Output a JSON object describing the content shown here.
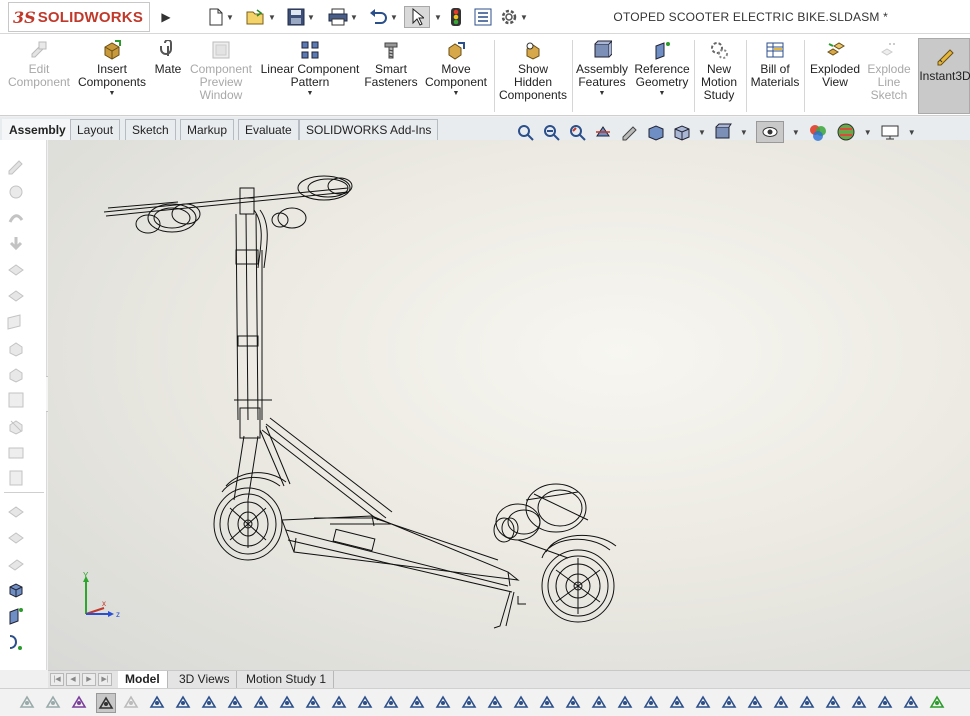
{
  "app": {
    "logo_mark": "3S",
    "logo_text": "SOLIDWORKS"
  },
  "titlebar": {
    "document_title": "OTOPED SCOOTER ELECTRIC BIKE.SLDASM *",
    "icons": [
      "new-document-icon",
      "open-icon",
      "save-icon",
      "print-icon",
      "undo-icon",
      "select-icon",
      "rebuild-icon",
      "file-properties-icon",
      "options-icon"
    ]
  },
  "command_manager": {
    "buttons": [
      {
        "label": "Edit\nComponent",
        "enabled": false,
        "has_dropdown": false,
        "icon": "edit-component-icon"
      },
      {
        "label": "Insert\nComponents",
        "enabled": true,
        "has_dropdown": true,
        "icon": "insert-components-icon"
      },
      {
        "label": "Mate",
        "enabled": true,
        "has_dropdown": false,
        "icon": "mate-icon"
      },
      {
        "label": "Component\nPreview\nWindow",
        "enabled": false,
        "has_dropdown": false,
        "icon": "component-preview-icon"
      },
      {
        "label": "Linear Component\nPattern",
        "enabled": true,
        "has_dropdown": true,
        "icon": "linear-pattern-icon"
      },
      {
        "label": "Smart\nFasteners",
        "enabled": true,
        "has_dropdown": false,
        "icon": "smart-fasteners-icon"
      },
      {
        "label": "Move\nComponent",
        "enabled": true,
        "has_dropdown": true,
        "icon": "move-component-icon"
      },
      {
        "label": "Show\nHidden\nComponents",
        "enabled": true,
        "has_dropdown": false,
        "icon": "show-hidden-icon"
      },
      {
        "label": "Assembly\nFeatures",
        "enabled": true,
        "has_dropdown": true,
        "icon": "assembly-features-icon"
      },
      {
        "label": "Reference\nGeometry",
        "enabled": true,
        "has_dropdown": true,
        "icon": "reference-geometry-icon"
      },
      {
        "label": "New\nMotion\nStudy",
        "enabled": true,
        "has_dropdown": false,
        "icon": "motion-study-icon"
      },
      {
        "label": "Bill of\nMaterials",
        "enabled": true,
        "has_dropdown": false,
        "icon": "bill-of-materials-icon"
      },
      {
        "label": "Exploded\nView",
        "enabled": true,
        "has_dropdown": false,
        "icon": "exploded-view-icon"
      },
      {
        "label": "Explode\nLine\nSketch",
        "enabled": false,
        "has_dropdown": false,
        "icon": "explode-line-icon"
      },
      {
        "label": "Instant3D",
        "enabled": true,
        "has_dropdown": false,
        "icon": "instant3d-icon"
      }
    ]
  },
  "tabs": [
    {
      "label": "Assembly",
      "active": true
    },
    {
      "label": "Layout",
      "active": false
    },
    {
      "label": "Sketch",
      "active": false
    },
    {
      "label": "Markup",
      "active": false
    },
    {
      "label": "Evaluate",
      "active": false
    },
    {
      "label": "SOLIDWORKS Add-Ins",
      "active": false
    }
  ],
  "triad": {
    "x": "x",
    "y": "Y",
    "z": "z"
  },
  "bottom_tabs": [
    {
      "label": "Model",
      "active": true
    },
    {
      "label": "3D Views",
      "active": false
    },
    {
      "label": "Motion Study 1",
      "active": false
    }
  ],
  "colors": {
    "accent": "#c0392b",
    "ribbon_bg": "#ffffff",
    "tab_bg": "#e8ecef",
    "viewport_center": "#f7f6f1",
    "wireframe": "#111111"
  }
}
